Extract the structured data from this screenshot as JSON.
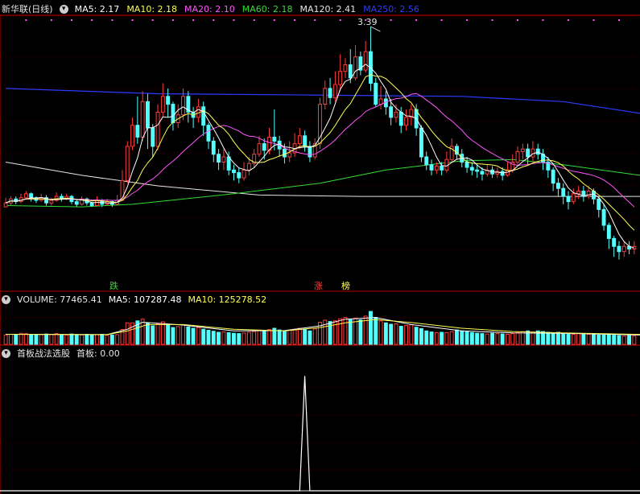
{
  "stock": {
    "title": "新华联(日线)"
  },
  "colors": {
    "up": "#ff3b3b",
    "down": "#54ffff",
    "ma5": "#ffffff",
    "ma10": "#ffff55",
    "ma20": "#ff55ff",
    "ma60": "#33dd33",
    "ma120": "#e6e6e6",
    "ma250": "#2b3bff",
    "grid": "#880000"
  },
  "price_header": [
    {
      "label": "MA5: 2.17",
      "color": "#ffffff"
    },
    {
      "label": "MA10: 2.18",
      "color": "#ffff55"
    },
    {
      "label": "MA20: 2.10",
      "color": "#ff55ff"
    },
    {
      "label": "MA60: 2.18",
      "color": "#33dd33"
    },
    {
      "label": "MA120: 2.41",
      "color": "#e6e6e6"
    },
    {
      "label": "MA250: 2.56",
      "color": "#2b3bff"
    }
  ],
  "volume_header": {
    "title": "VOLUME: 77465.41",
    "ma5": "MA5: 107287.48",
    "ma10": "MA10: 125278.52"
  },
  "indicator_header": {
    "title": "首板战法选股",
    "value": "首板: 0.00"
  },
  "markers": {
    "high_label": "3.39",
    "die": "跌",
    "zhang": "涨",
    "bang": "榜"
  },
  "chart_data": {
    "type": "candlestick",
    "title": "新华联(日线)",
    "ylim": [
      1.55,
      3.47
    ],
    "high": 3.39,
    "candles": [
      [
        2.02,
        2.05,
        2.04,
        2.09
      ],
      [
        2.05,
        2.08,
        2.03,
        2.1
      ],
      [
        2.08,
        2.06,
        2.04,
        2.1
      ],
      [
        2.06,
        2.09,
        2.05,
        2.12
      ],
      [
        2.09,
        2.12,
        2.08,
        2.14
      ],
      [
        2.12,
        2.09,
        2.06,
        2.13
      ],
      [
        2.09,
        2.07,
        2.05,
        2.1
      ],
      [
        2.07,
        2.09,
        2.06,
        2.12
      ],
      [
        2.09,
        2.05,
        2.03,
        2.11
      ],
      [
        2.05,
        2.07,
        2.03,
        2.09
      ],
      [
        2.07,
        2.1,
        2.06,
        2.13
      ],
      [
        2.1,
        2.08,
        2.06,
        2.12
      ],
      [
        2.08,
        2.1,
        2.07,
        2.12
      ],
      [
        2.1,
        2.06,
        2.04,
        2.11
      ],
      [
        2.06,
        2.04,
        2.02,
        2.08
      ],
      [
        2.04,
        2.08,
        2.03,
        2.1
      ],
      [
        2.08,
        2.05,
        2.03,
        2.09
      ],
      [
        2.05,
        2.03,
        2.02,
        2.06
      ],
      [
        2.03,
        2.07,
        2.03,
        2.1
      ],
      [
        2.07,
        2.04,
        2.02,
        2.08
      ],
      [
        2.04,
        2.06,
        2.03,
        2.08
      ],
      [
        2.06,
        2.04,
        2.02,
        2.07
      ],
      [
        2.04,
        2.07,
        2.04,
        2.11
      ],
      [
        2.07,
        2.22,
        2.07,
        2.3
      ],
      [
        2.22,
        2.48,
        2.2,
        2.52
      ],
      [
        2.48,
        2.64,
        2.45,
        2.7
      ],
      [
        2.64,
        2.55,
        2.5,
        2.86
      ],
      [
        2.55,
        2.82,
        2.52,
        2.9
      ],
      [
        2.82,
        2.62,
        2.46,
        2.88
      ],
      [
        2.62,
        2.48,
        2.4,
        2.65
      ],
      [
        2.48,
        2.74,
        2.45,
        2.8
      ],
      [
        2.74,
        2.86,
        2.7,
        2.96
      ],
      [
        2.86,
        2.8,
        2.7,
        2.92
      ],
      [
        2.8,
        2.66,
        2.6,
        2.82
      ],
      [
        2.66,
        2.72,
        2.62,
        2.8
      ],
      [
        2.72,
        2.86,
        2.68,
        2.92
      ],
      [
        2.86,
        2.74,
        2.66,
        2.9
      ],
      [
        2.74,
        2.7,
        2.62,
        2.78
      ],
      [
        2.7,
        2.78,
        2.66,
        2.84
      ],
      [
        2.78,
        2.64,
        2.56,
        2.82
      ],
      [
        2.64,
        2.52,
        2.46,
        2.66
      ],
      [
        2.52,
        2.42,
        2.36,
        2.55
      ],
      [
        2.42,
        2.36,
        2.3,
        2.46
      ],
      [
        2.36,
        2.4,
        2.3,
        2.46
      ],
      [
        2.4,
        2.3,
        2.26,
        2.44
      ],
      [
        2.3,
        2.28,
        2.22,
        2.34
      ],
      [
        2.28,
        2.24,
        2.2,
        2.32
      ],
      [
        2.24,
        2.3,
        2.22,
        2.36
      ],
      [
        2.3,
        2.35,
        2.26,
        2.4
      ],
      [
        2.35,
        2.42,
        2.32,
        2.46
      ],
      [
        2.42,
        2.5,
        2.4,
        2.56
      ],
      [
        2.5,
        2.45,
        2.38,
        2.54
      ],
      [
        2.45,
        2.55,
        2.42,
        2.62
      ],
      [
        2.55,
        2.52,
        2.45,
        2.76
      ],
      [
        2.52,
        2.46,
        2.4,
        2.56
      ],
      [
        2.46,
        2.4,
        2.35,
        2.5
      ],
      [
        2.4,
        2.43,
        2.36,
        2.52
      ],
      [
        2.43,
        2.5,
        2.4,
        2.58
      ],
      [
        2.5,
        2.56,
        2.46,
        2.62
      ],
      [
        2.56,
        2.48,
        2.44,
        2.6
      ],
      [
        2.48,
        2.4,
        2.36,
        2.52
      ],
      [
        2.4,
        2.5,
        2.38,
        2.54
      ],
      [
        2.5,
        2.8,
        2.46,
        2.85
      ],
      [
        2.8,
        2.92,
        2.76,
        2.98
      ],
      [
        2.92,
        2.85,
        2.8,
        3.0
      ],
      [
        2.85,
        2.95,
        2.82,
        3.05
      ],
      [
        2.95,
        3.05,
        2.9,
        3.18
      ],
      [
        3.05,
        3.1,
        3.0,
        3.15
      ],
      [
        3.1,
        3.0,
        2.96,
        3.22
      ],
      [
        3.0,
        3.16,
        2.98,
        3.25
      ],
      [
        3.16,
        3.06,
        3.02,
        3.2
      ],
      [
        3.06,
        3.2,
        3.04,
        3.28
      ],
      [
        3.2,
        2.96,
        2.9,
        3.39
      ],
      [
        2.96,
        2.8,
        2.78,
        3.0
      ],
      [
        2.8,
        2.84,
        2.76,
        2.94
      ],
      [
        2.84,
        2.78,
        2.72,
        2.9
      ],
      [
        2.78,
        2.7,
        2.64,
        2.84
      ],
      [
        2.7,
        2.74,
        2.66,
        2.8
      ],
      [
        2.74,
        2.64,
        2.58,
        2.78
      ],
      [
        2.64,
        2.7,
        2.6,
        2.76
      ],
      [
        2.7,
        2.76,
        2.64,
        2.8
      ],
      [
        2.76,
        2.62,
        2.56,
        2.8
      ],
      [
        2.62,
        2.4,
        2.36,
        2.64
      ],
      [
        2.4,
        2.34,
        2.3,
        2.44
      ],
      [
        2.34,
        2.3,
        2.26,
        2.38
      ],
      [
        2.3,
        2.33,
        2.27,
        2.36
      ],
      [
        2.33,
        2.3,
        2.26,
        2.36
      ],
      [
        2.3,
        2.38,
        2.28,
        2.44
      ],
      [
        2.38,
        2.48,
        2.36,
        2.54
      ],
      [
        2.48,
        2.42,
        2.38,
        2.5
      ],
      [
        2.42,
        2.36,
        2.32,
        2.46
      ],
      [
        2.36,
        2.32,
        2.28,
        2.4
      ],
      [
        2.32,
        2.3,
        2.26,
        2.36
      ],
      [
        2.3,
        2.29,
        2.24,
        2.34
      ],
      [
        2.29,
        2.27,
        2.22,
        2.32
      ],
      [
        2.27,
        2.3,
        2.25,
        2.34
      ],
      [
        2.3,
        2.27,
        2.24,
        2.33
      ],
      [
        2.27,
        2.29,
        2.24,
        2.32
      ],
      [
        2.29,
        2.26,
        2.22,
        2.32
      ],
      [
        2.26,
        2.3,
        2.25,
        2.36
      ],
      [
        2.3,
        2.36,
        2.28,
        2.42
      ],
      [
        2.36,
        2.44,
        2.34,
        2.48
      ],
      [
        2.44,
        2.46,
        2.38,
        2.5
      ],
      [
        2.46,
        2.4,
        2.34,
        2.5
      ],
      [
        2.4,
        2.46,
        2.36,
        2.52
      ],
      [
        2.46,
        2.42,
        2.38,
        2.5
      ],
      [
        2.42,
        2.36,
        2.3,
        2.46
      ],
      [
        2.36,
        2.3,
        2.24,
        2.4
      ],
      [
        2.3,
        2.2,
        2.14,
        2.32
      ],
      [
        2.2,
        2.16,
        2.1,
        2.24
      ],
      [
        2.16,
        2.1,
        2.04,
        2.2
      ],
      [
        2.1,
        2.06,
        2.0,
        2.14
      ],
      [
        2.06,
        2.12,
        2.04,
        2.16
      ],
      [
        2.12,
        2.14,
        2.08,
        2.18
      ],
      [
        2.14,
        2.1,
        2.06,
        2.18
      ],
      [
        2.1,
        2.14,
        2.08,
        2.18
      ],
      [
        2.14,
        2.08,
        2.04,
        2.16
      ],
      [
        2.08,
        2.0,
        1.94,
        2.1
      ],
      [
        2.0,
        1.88,
        1.84,
        2.04
      ],
      [
        1.88,
        1.78,
        1.7,
        1.9
      ],
      [
        1.78,
        1.72,
        1.64,
        1.8
      ],
      [
        1.72,
        1.68,
        1.62,
        1.76
      ],
      [
        1.68,
        1.72,
        1.64,
        1.76
      ],
      [
        1.72,
        1.7,
        1.66,
        1.76
      ],
      [
        1.7,
        1.72,
        1.66,
        1.76
      ]
    ],
    "ma_long": {
      "ma250": [
        [
          0,
          2.92
        ],
        [
          30,
          2.88
        ],
        [
          60,
          2.87
        ],
        [
          90,
          2.86
        ],
        [
          110,
          2.82
        ],
        [
          122,
          2.75
        ],
        [
          127,
          2.72
        ]
      ],
      "ma120": [
        [
          0,
          2.36
        ],
        [
          15,
          2.26
        ],
        [
          30,
          2.18
        ],
        [
          50,
          2.11
        ],
        [
          70,
          2.1
        ],
        [
          90,
          2.1
        ],
        [
          110,
          2.1
        ],
        [
          127,
          2.1
        ]
      ],
      "ma60": [
        [
          0,
          2.03
        ],
        [
          15,
          2.02
        ],
        [
          25,
          2.04
        ],
        [
          45,
          2.12
        ],
        [
          62,
          2.2
        ],
        [
          75,
          2.3
        ],
        [
          90,
          2.37
        ],
        [
          100,
          2.38
        ],
        [
          110,
          2.34
        ],
        [
          127,
          2.25
        ]
      ]
    },
    "volume": [
      56,
      60,
      58,
      66,
      64,
      56,
      60,
      58,
      62,
      60,
      64,
      58,
      56,
      62,
      58,
      56,
      60,
      54,
      58,
      60,
      54,
      56,
      58,
      88,
      128,
      128,
      140,
      150,
      128,
      110,
      122,
      134,
      120,
      100,
      106,
      116,
      104,
      96,
      100,
      90,
      84,
      78,
      72,
      74,
      70,
      66,
      64,
      68,
      72,
      76,
      84,
      80,
      88,
      96,
      86,
      80,
      84,
      90,
      96,
      88,
      80,
      92,
      132,
      144,
      136,
      140,
      152,
      160,
      148,
      156,
      146,
      168,
      196,
      160,
      140,
      128,
      120,
      122,
      108,
      112,
      118,
      102,
      94,
      80,
      74,
      70,
      72,
      70,
      76,
      86,
      80,
      74,
      70,
      66,
      64,
      62,
      66,
      64,
      62,
      60,
      64,
      70,
      76,
      80,
      74,
      80,
      76,
      72,
      68,
      72,
      66,
      62,
      60,
      64,
      62,
      60,
      58,
      56,
      56,
      58,
      54,
      52,
      50,
      52,
      50,
      48,
      46,
      44
    ],
    "volume_ma": {
      "ma5": [
        [
          0,
          60
        ],
        [
          20,
          58
        ],
        [
          24,
          90
        ],
        [
          27,
          132
        ],
        [
          35,
          115
        ],
        [
          45,
          80
        ],
        [
          55,
          82
        ],
        [
          62,
          110
        ],
        [
          67,
          150
        ],
        [
          73,
          160
        ],
        [
          80,
          118
        ],
        [
          90,
          80
        ],
        [
          100,
          68
        ],
        [
          110,
          66
        ],
        [
          127,
          54
        ]
      ],
      "ma10": [
        [
          0,
          60
        ],
        [
          20,
          58
        ],
        [
          24,
          80
        ],
        [
          28,
          118
        ],
        [
          35,
          118
        ],
        [
          45,
          90
        ],
        [
          55,
          80
        ],
        [
          62,
          100
        ],
        [
          67,
          128
        ],
        [
          73,
          148
        ],
        [
          80,
          130
        ],
        [
          90,
          96
        ],
        [
          100,
          76
        ],
        [
          110,
          68
        ],
        [
          127,
          58
        ]
      ]
    },
    "volume_ylim": [
      0,
      230
    ],
    "indicator": {
      "series": "首板",
      "spike_index": 59,
      "spike_value": 1,
      "ylim": [
        0,
        1.15
      ]
    }
  }
}
